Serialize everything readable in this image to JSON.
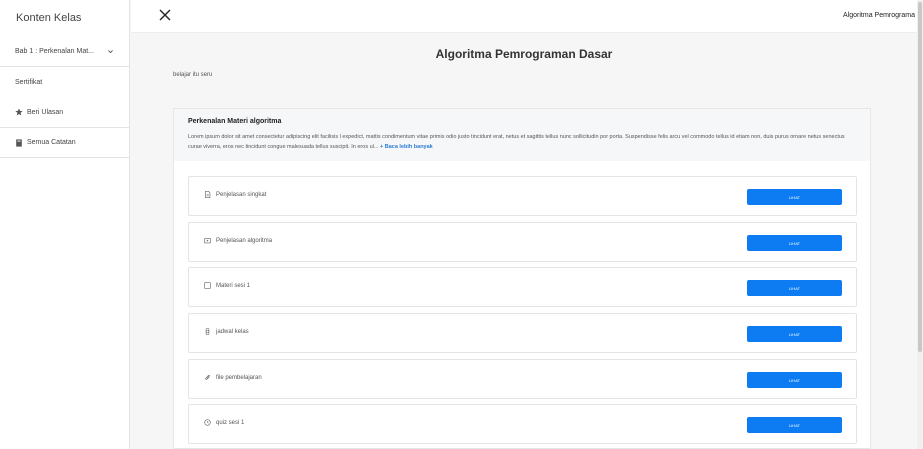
{
  "sidebar": {
    "title": "Konten Kelas",
    "chapter": "Bab 1 : Perkenalan Mat...",
    "items": [
      {
        "label": "Sertifikat"
      },
      {
        "label": "Beri Ulasan"
      },
      {
        "label": "Semua Catatan"
      }
    ]
  },
  "topbar": {
    "course_name": "Algoritma Pemrograma"
  },
  "main": {
    "title": "Algoritma Pemrograman Dasar",
    "subtitle": "belajar itu seru",
    "intro": {
      "title": "Perkenalan Materi algoritma",
      "body": "Lorem ipsum dolor sit amet consectetur adipiscing elit facilisis l expedict, mattis condimentum vitae primis odio justo tincidunt erat, netus et sagittis tellus nunc sollicitudin por porta. Suspendisse felis arcu vel commodo tellus id etiam non, duis purus ornare netus senectus curae viverra, eros nec tincidunt congue malesuada tellus suscipit. In eros ul...",
      "read_more": "+ Baca lebih banyak"
    },
    "items": [
      {
        "label": "Penjelasan singkat",
        "icon": "document-icon",
        "button": "LIHAT"
      },
      {
        "label": "Penjelasan algoritma",
        "icon": "video-icon",
        "button": "LIHAT"
      },
      {
        "label": "Materi sesi 1",
        "icon": "square-icon",
        "button": "LIHAT"
      },
      {
        "label": "jadwal kelas",
        "icon": "watch-icon",
        "button": "LIHAT"
      },
      {
        "label": "file pembelajaran",
        "icon": "paperclip-icon",
        "button": "LIHAT"
      },
      {
        "label": "quiz sesi 1",
        "icon": "clock-icon",
        "button": "LIHAT"
      }
    ]
  },
  "colors": {
    "accent": "#0d7cf2",
    "link": "#2a7bd4"
  }
}
